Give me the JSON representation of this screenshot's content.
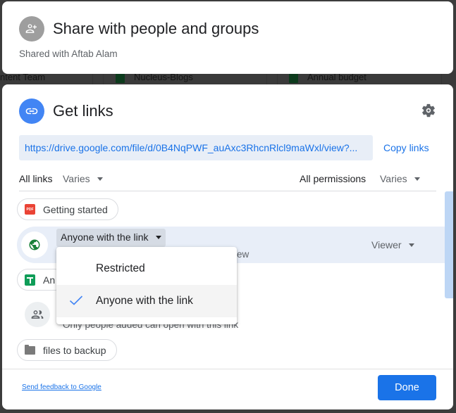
{
  "background": {
    "cells": [
      "ntent Team",
      "Nucleus-Blogs",
      "Annual budget"
    ]
  },
  "share_panel": {
    "icon": "person-add-icon",
    "title": "Share with people and groups",
    "subtitle": "Shared with Aftab Alam"
  },
  "links_panel": {
    "icon": "link-icon",
    "title": "Get links",
    "settings_icon": "gear-icon",
    "url": "https://drive.google.com/file/d/0B4NqPWF_auAxc3RhcnRlcl9maWxl/view?...",
    "copy_label": "Copy links",
    "filters": {
      "links_label": "All links",
      "links_value": "Varies",
      "permissions_label": "All permissions",
      "permissions_value": "Varies"
    },
    "items": [
      {
        "type": "pdf",
        "name": "Getting started"
      },
      {
        "type": "sheets",
        "name": "An"
      },
      {
        "type": "folder",
        "name": "files to backup"
      }
    ],
    "link_setting": {
      "access": "Anyone with the link",
      "description_visible": "n view",
      "role": "Viewer"
    },
    "restricted_description": "Only people added can open with this link",
    "feedback_link": "Send feedback to Google",
    "done_label": "Done"
  },
  "access_menu": {
    "options": [
      {
        "label": "Restricted",
        "selected": false
      },
      {
        "label": "Anyone with the link",
        "selected": true
      }
    ]
  },
  "colors": {
    "accent": "#1a73e8",
    "link_icon_bg": "#4285f4",
    "globe_green": "#188038",
    "pdf_red": "#ea4335",
    "sheets_green": "#0f9d58"
  }
}
